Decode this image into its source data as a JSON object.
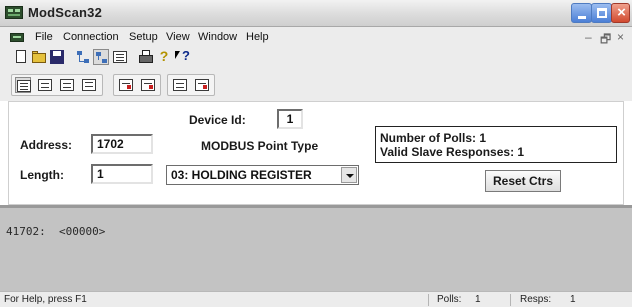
{
  "window": {
    "title": "ModScan32"
  },
  "menu": {
    "items": [
      "File",
      "Connection",
      "Setup",
      "View",
      "Window",
      "Help"
    ],
    "mdi_controls": [
      "–",
      "🗗",
      "×"
    ]
  },
  "toolbar1": {
    "icons": [
      "new-document-icon",
      "open-folder-icon",
      "save-disk-icon",
      "connect-network-icon",
      "disconnect-network-icon",
      "display-options-icon",
      "print-icon",
      "help-icon",
      "context-help-icon"
    ],
    "help_glyph": "?",
    "context_help_glyph": "?"
  },
  "toolbar2": {
    "icons": [
      "display-binary-icon",
      "display-decimal-icon",
      "display-hex-icon",
      "display-float-icon",
      "display-swapped-icon",
      "display-double-icon",
      "display-protocol-icon",
      "display-traffic-icon"
    ]
  },
  "form": {
    "address_label": "Address:",
    "address_value": "1702",
    "length_label": "Length:",
    "length_value": "1",
    "device_id_label": "Device Id:",
    "device_id_value": "1",
    "point_type_label": "MODBUS Point Type",
    "point_type_value": "03: HOLDING REGISTER",
    "polls_label": "Number of Polls: 1",
    "responses_label": "Valid Slave Responses: 1",
    "reset_button": "Reset Ctrs"
  },
  "data_area": {
    "lines": [
      "41702:  <00000>"
    ]
  },
  "statusbar": {
    "help_text": "For Help, press F1",
    "polls_label": "Polls:",
    "polls_value": "1",
    "resps_label": "Resps:",
    "resps_value": "1"
  },
  "colors": {
    "title_bar": "#dcdcdc",
    "data_area_bg": "#c3c3c3",
    "close_button": "#d14a2f",
    "window_buttons": "#4c7fd6"
  }
}
